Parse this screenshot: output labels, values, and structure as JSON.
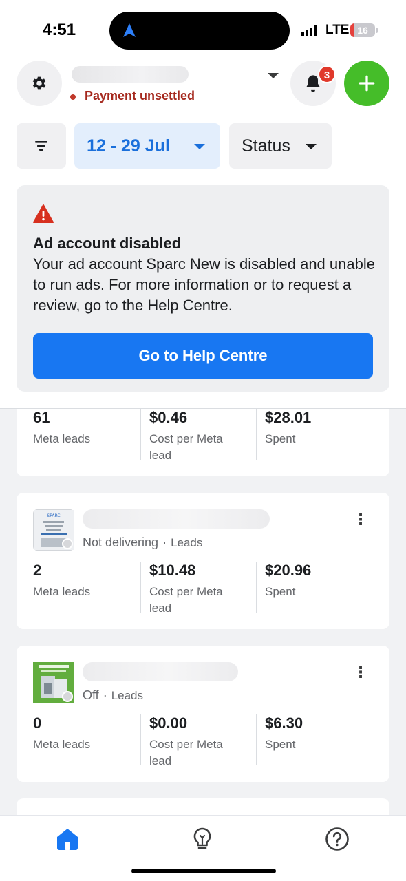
{
  "status_bar": {
    "time": "4:51",
    "network": "LTE",
    "battery": "16",
    "battery_level": 0.16
  },
  "header": {
    "payment_status": "Payment unsettled",
    "notification_count": "3",
    "date_range": "12 - 29 Jul",
    "status_filter": "Status"
  },
  "alert": {
    "title": "Ad account disabled",
    "body": "Your ad account Sparc New is disabled and unable to run ads. For more information or to request a review, go to the Help Centre.",
    "button": "Go to Help Centre",
    "accent": "#e0392b"
  },
  "campaigns": [
    {
      "status": "",
      "type": "",
      "metrics": [
        {
          "value": "61",
          "label": "Meta leads"
        },
        {
          "value": "$0.46",
          "label": "Cost per Meta lead"
        },
        {
          "value": "$28.01",
          "label": "Spent"
        }
      ]
    },
    {
      "status": "Not delivering",
      "type": "Leads",
      "metrics": [
        {
          "value": "2",
          "label": "Meta leads"
        },
        {
          "value": "$10.48",
          "label": "Cost per Meta lead"
        },
        {
          "value": "$20.96",
          "label": "Spent"
        }
      ]
    },
    {
      "status": "Off",
      "type": "Leads",
      "metrics": [
        {
          "value": "0",
          "label": "Meta leads"
        },
        {
          "value": "$0.00",
          "label": "Cost per Meta lead"
        },
        {
          "value": "$6.30",
          "label": "Spent"
        }
      ]
    }
  ],
  "colors": {
    "brand_blue": "#1877f2",
    "add_green": "#45bd29",
    "warning_red": "#a5281d"
  },
  "bottom_nav": {
    "items": [
      "home-icon",
      "lightbulb-icon",
      "help-icon"
    ],
    "active": "home-icon"
  }
}
